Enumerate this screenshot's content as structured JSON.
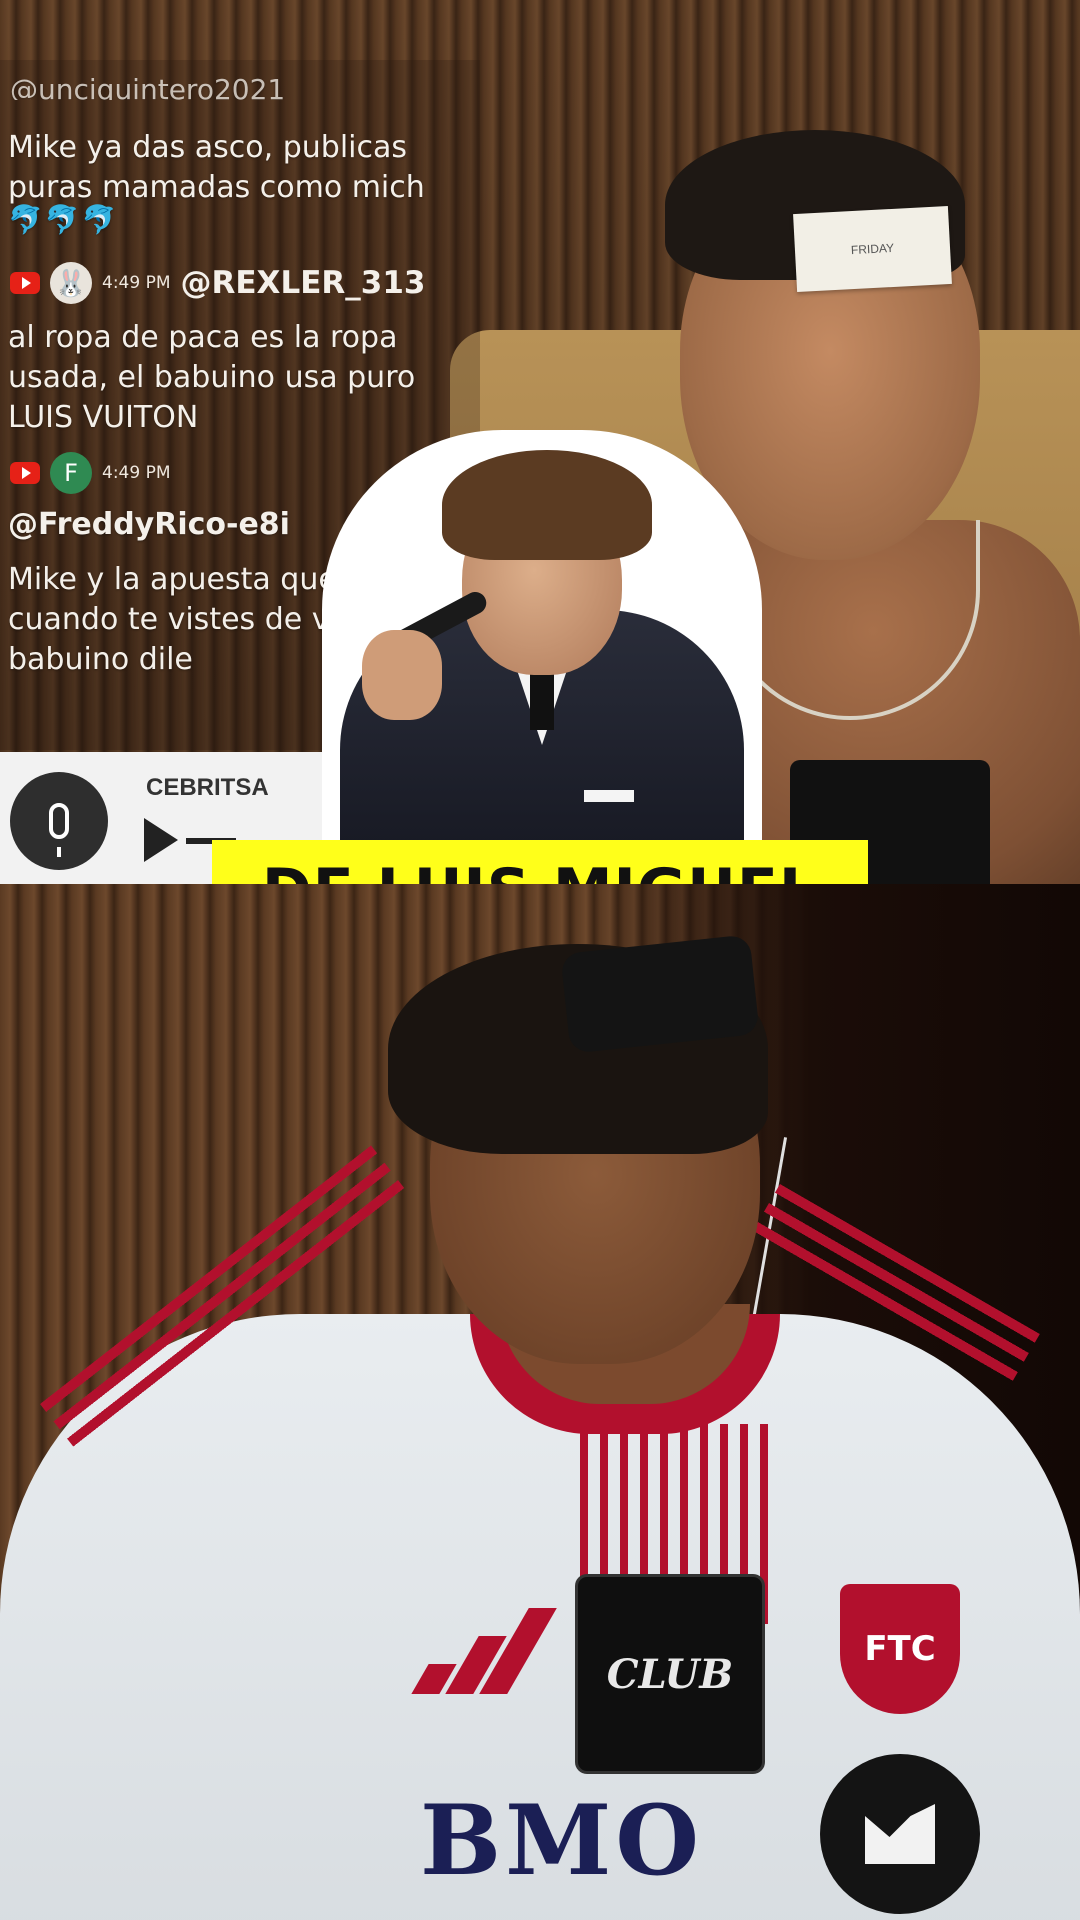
{
  "chat": {
    "cut_handle": "@unciquintero2021",
    "message1": [
      "Mike ya das asco, publicas",
      "puras mamadas como mich"
    ],
    "emojis": "🐬🐬🐬",
    "entry2": {
      "time": "4:49 PM",
      "handle": "@REXLER_313",
      "message": [
        "al ropa de paca es la ropa",
        "usada, el babuino usa puro",
        "LUIS VUITON"
      ]
    },
    "entry3": {
      "avatar_letter": "F",
      "time": "4:49 PM",
      "handle": "@FreddyRico-e8i",
      "message": [
        "Mike y la apuesta que wey? Pa",
        "cuando te vistes de viej",
        "babuino dile"
      ]
    }
  },
  "audio": {
    "name": "CEBRITSA"
  },
  "caption": "DE LUIS MIGUEL",
  "top_person": {
    "forehead_card": "FRIDAY"
  },
  "bottom_person": {
    "crest": "FTC",
    "badge": "CLUB",
    "sponsor": "BMO"
  },
  "colors": {
    "caption_bg": "#ffff1a",
    "jersey_red": "#b2102d",
    "youtube_red": "#e62117"
  },
  "icons": [
    "youtube-icon",
    "microphone-icon",
    "play-icon"
  ]
}
